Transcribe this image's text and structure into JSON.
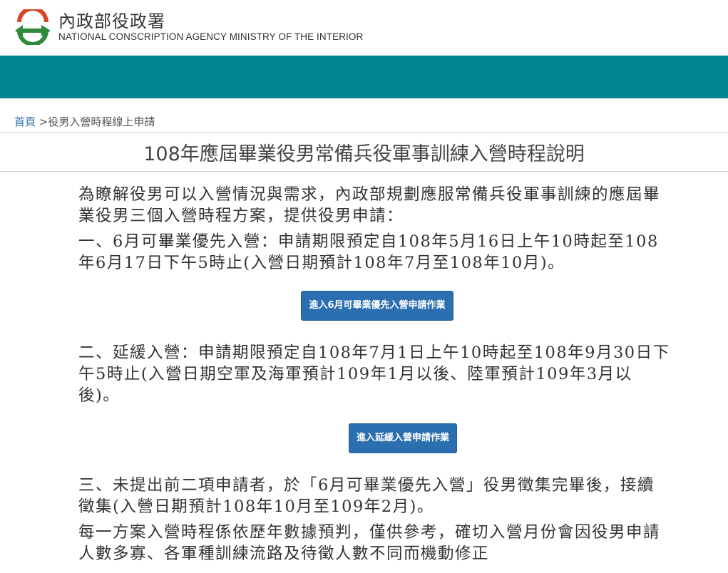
{
  "header": {
    "agency_cn": "內政部役政署",
    "agency_en": "NATIONAL CONSCRIPTION AGENCY MINISTRY OF THE INTERIOR",
    "logo_icon": "agency-logo-icon",
    "colors": {
      "nav": "#00878f",
      "logo_green": "#2e8b3a",
      "logo_red": "#d8452a",
      "button": "#2c6fb0"
    }
  },
  "breadcrumb": {
    "home": "首頁",
    "separator": ">",
    "current": "役男入營時程線上申請"
  },
  "page": {
    "title": "108年應屆畢業役男常備兵役軍事訓練入營時程說明"
  },
  "content": {
    "intro": "為瞭解役男可以入營情況與需求，內政部規劃應服常備兵役軍事訓練的應屆畢業役男三個入營時程方案，提供役男申請：",
    "item1": "一、6月可畢業優先入營：申請期限預定自108年5月16日上午10時起至108年6月17日下午5時止(入營日期預計108年7月至108年10月)。",
    "button1": "進入6月可畢業優先入營申請作業",
    "item2": "二、延緩入營：申請期限預定自108年7月1日上午10時起至108年9月30日下午5時止(入營日期空軍及海軍預計109年1月以後、陸軍預計109年3月以後)。",
    "button2": "進入延緩入營申請作業",
    "item3": "三、未提出前二項申請者，於「6月可畢業優先入營」役男徵集完畢後，接續徵集(入營日期預計108年10月至109年2月)。",
    "note": "每一方案入營時程係依歷年數據預判，僅供參考，確切入營月份會因役男申請人數多寡、各軍種訓練流路及待徵人數不同而機動修正"
  }
}
